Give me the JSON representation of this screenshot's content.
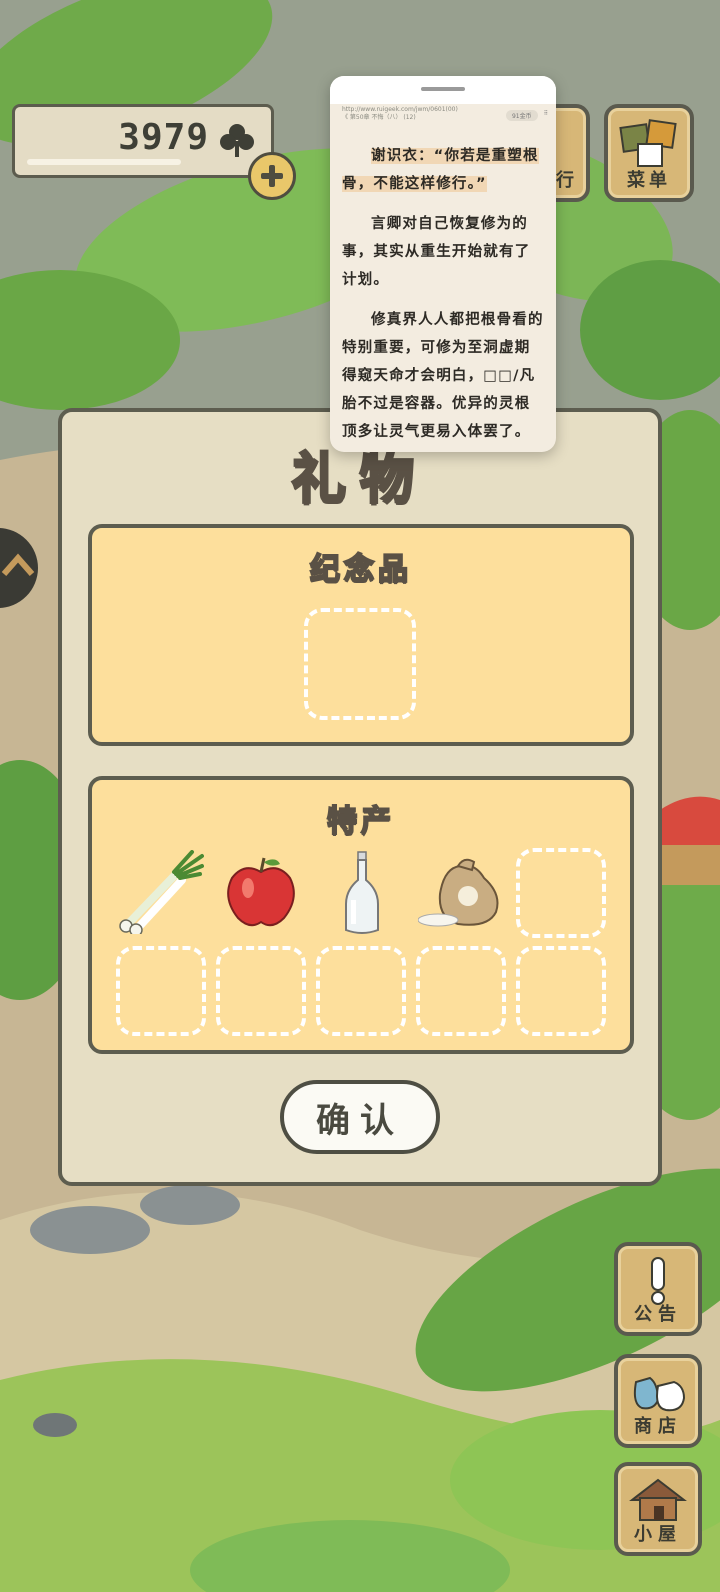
{
  "currency": {
    "amount": "3979",
    "icon": "clover-icon"
  },
  "menu_buttons": {
    "travel_label": "行",
    "menu_label": "菜单"
  },
  "reader": {
    "meta_line1": "http://www.ruigeek.com/jwm/0601(00)",
    "meta_line2": "《 第50章 不悔（八） (12)",
    "meta_right": "91金币",
    "paragraphs": [
      "谢识衣：“你若是重塑根骨，不能这样修行。”",
      "言卿对自己恢复修为的事，其实从重生开始就有了计划。",
      "修真界人人都把根骨看的特别重要，可修为至洞虚期得窥天命才会明白，□□/凡胎不过是容器。优异的灵根顶多让灵气更易入体罢了。"
    ]
  },
  "gift": {
    "title": "礼物",
    "souvenir_title": "纪念品",
    "specialty_title": "特产",
    "specialty_items": [
      "green-onion",
      "apple",
      "glass-bottle",
      "rice-sack"
    ],
    "confirm_label": "确认"
  },
  "bottom_buttons": {
    "notice_label": "公告",
    "shop_label": "商店",
    "house_label": "小屋"
  }
}
